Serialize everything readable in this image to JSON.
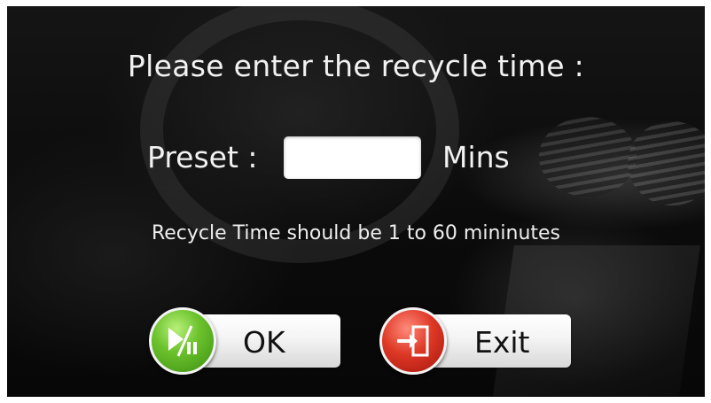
{
  "dialog": {
    "title": "Please enter the recycle time :",
    "preset_label": "Preset :",
    "preset_value": "",
    "unit_label": "Mins",
    "hint": "Recycle Time should be 1 to 60 mininutes"
  },
  "buttons": {
    "ok": {
      "label": "OK",
      "icon": "play-pause-icon",
      "color": "#4fa81f"
    },
    "exit": {
      "label": "Exit",
      "icon": "exit-door-icon",
      "color": "#d1301e"
    }
  }
}
